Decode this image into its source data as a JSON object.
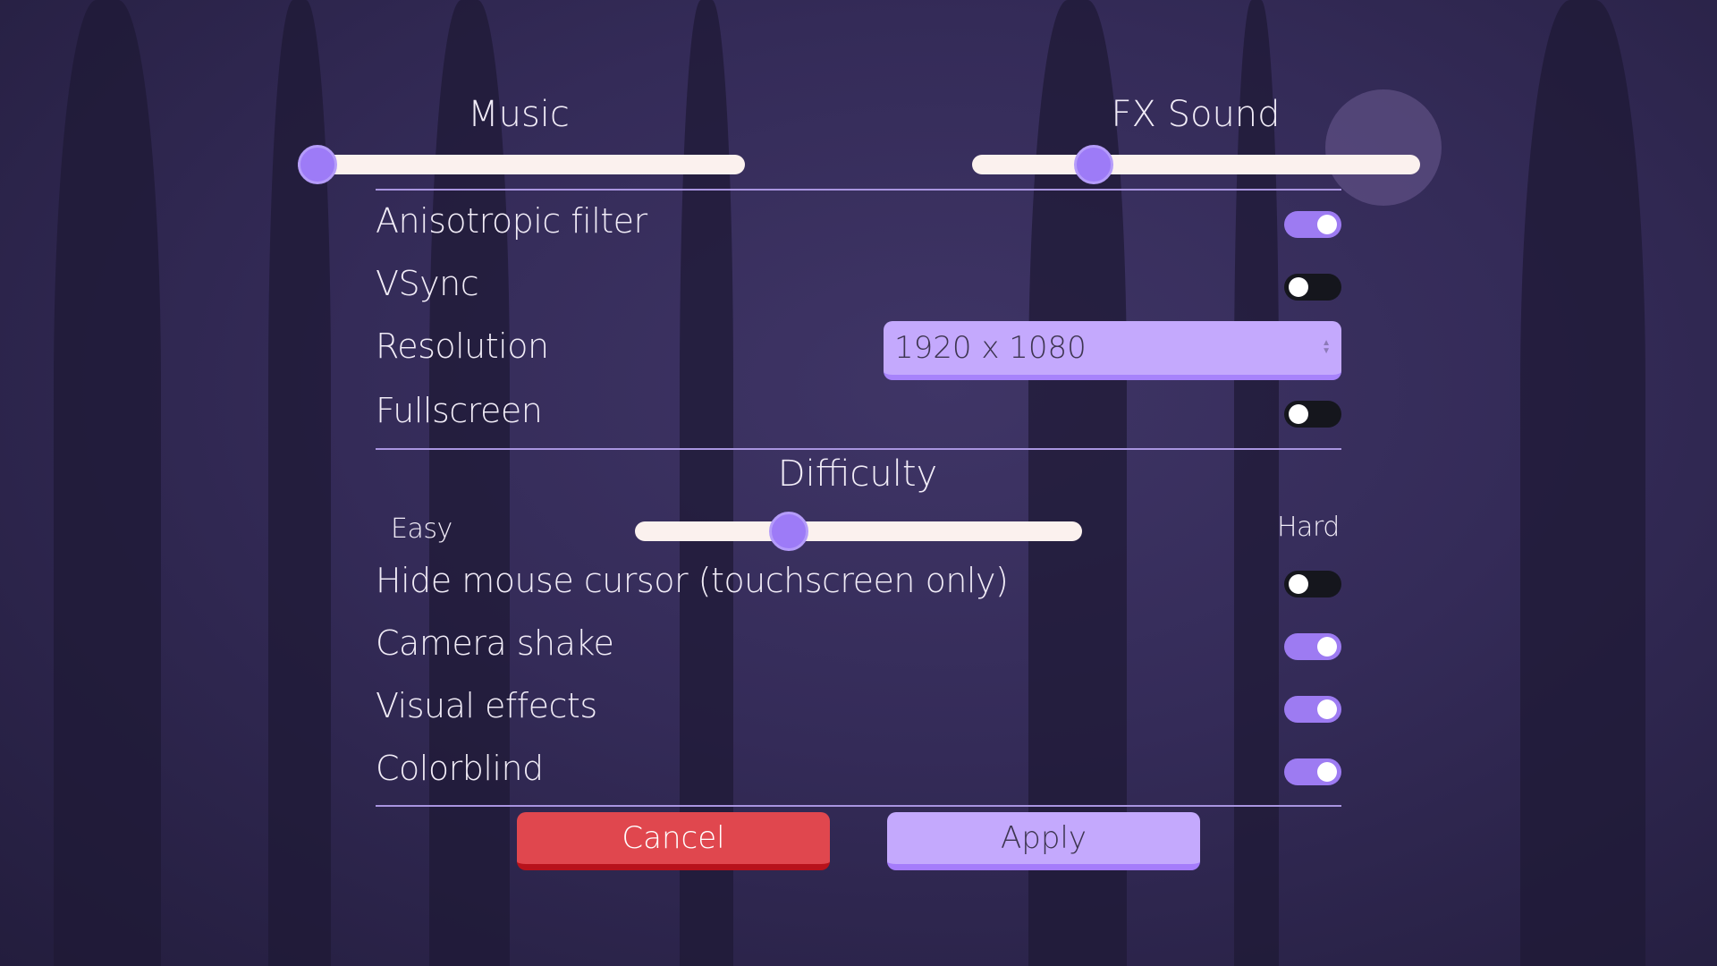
{
  "audio": {
    "music": {
      "label": "Music",
      "value": 0
    },
    "fx": {
      "label": "FX Sound",
      "value": 0.25
    }
  },
  "settings": [
    {
      "label": "Anisotropic filter",
      "type": "toggle",
      "on": true
    },
    {
      "label": "VSync",
      "type": "toggle",
      "on": false
    },
    {
      "label": "Resolution",
      "type": "select",
      "value": "1920 x 1080"
    },
    {
      "label": "Fullscreen",
      "type": "toggle",
      "on": false
    }
  ],
  "difficulty": {
    "title": "Difficulty",
    "min_label": "Easy",
    "max_label": "Hard",
    "value": 0.33
  },
  "toggles": [
    {
      "label": "Hide mouse cursor (touchscreen only)",
      "on": false
    },
    {
      "label": "Camera shake",
      "on": true
    },
    {
      "label": "Visual effects",
      "on": true
    },
    {
      "label": "Colorblind",
      "on": true
    }
  ],
  "buttons": {
    "cancel": "Cancel",
    "apply": "Apply"
  },
  "colors": {
    "accent": "#9d7bf7",
    "cancel": "#e0474e",
    "apply": "#c4a9fd",
    "track": "#fbf1ee"
  }
}
